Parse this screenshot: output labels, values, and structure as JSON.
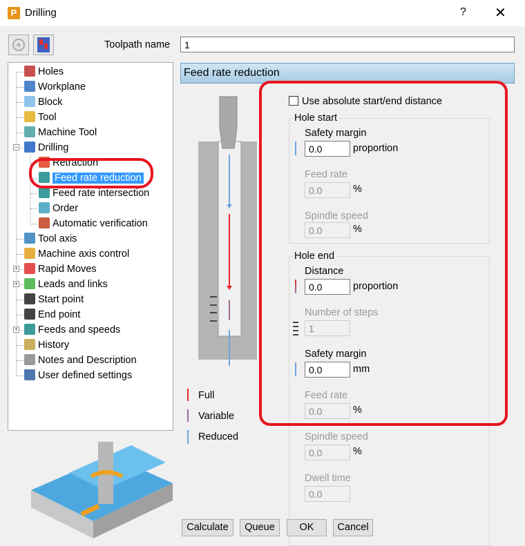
{
  "window": {
    "title": "Drilling",
    "help": "?",
    "close": "✕",
    "logo": "P"
  },
  "toolpath_name": {
    "label": "Toolpath name",
    "value": "1"
  },
  "tree": [
    {
      "label": "Holes",
      "level": 0,
      "icon": "holes-icon"
    },
    {
      "label": "Workplane",
      "level": 0,
      "icon": "workplane-icon"
    },
    {
      "label": "Block",
      "level": 0,
      "icon": "block-icon"
    },
    {
      "label": "Tool",
      "level": 0,
      "icon": "tool-icon"
    },
    {
      "label": "Machine Tool",
      "level": 0,
      "icon": "machine-tool-icon"
    },
    {
      "label": "Drilling",
      "level": 0,
      "icon": "drilling-icon",
      "expander": "−"
    },
    {
      "label": "Retraction",
      "level": 1,
      "icon": "retraction-icon"
    },
    {
      "label": "Feed rate reduction",
      "level": 1,
      "icon": "feed-rate-icon",
      "selected": true
    },
    {
      "label": "Feed rate intersection",
      "level": 1,
      "icon": "feed-rate-icon"
    },
    {
      "label": "Order",
      "level": 1,
      "icon": "order-icon"
    },
    {
      "label": "Automatic verification",
      "level": 1,
      "icon": "verification-icon"
    },
    {
      "label": "Tool axis",
      "level": 0,
      "icon": "tool-axis-icon"
    },
    {
      "label": "Machine axis control",
      "level": 0,
      "icon": "machine-axis-icon"
    },
    {
      "label": "Rapid Moves",
      "level": 0,
      "icon": "rapid-moves-icon",
      "expander": "+"
    },
    {
      "label": "Leads and links",
      "level": 0,
      "icon": "leads-links-icon",
      "expander": "+"
    },
    {
      "label": "Start point",
      "level": 0,
      "icon": "start-point-icon"
    },
    {
      "label": "End point",
      "level": 0,
      "icon": "end-point-icon"
    },
    {
      "label": "Feeds and speeds",
      "level": 0,
      "icon": "feeds-speeds-icon",
      "expander": "+"
    },
    {
      "label": "History",
      "level": 0,
      "icon": "history-icon"
    },
    {
      "label": "Notes and Description",
      "level": 0,
      "icon": "notes-icon"
    },
    {
      "label": "User defined settings",
      "level": 0,
      "icon": "user-settings-icon"
    }
  ],
  "panel": {
    "title": "Feed rate reduction"
  },
  "legend": {
    "full": "Full",
    "variable": "Variable",
    "reduced": "Reduced"
  },
  "form": {
    "absolute_label": "Use absolute start/end distance",
    "absolute_checked": false,
    "hole_start": {
      "title": "Hole start",
      "safety_margin": {
        "label": "Safety margin",
        "value": "0.0",
        "unit": "proportion"
      },
      "feed_rate": {
        "label": "Feed rate",
        "value": "0.0",
        "unit": "%"
      },
      "spindle_speed": {
        "label": "Spindle speed",
        "value": "0.0",
        "unit": "%"
      }
    },
    "hole_end": {
      "title": "Hole end",
      "distance": {
        "label": "Distance",
        "value": "0.0",
        "unit": "proportion"
      },
      "steps": {
        "label": "Number of steps",
        "value": "1"
      },
      "safety_margin": {
        "label": "Safety margin",
        "value": "0.0",
        "unit": "mm"
      },
      "feed_rate": {
        "label": "Feed rate",
        "value": "0.0",
        "unit": "%"
      },
      "spindle_speed": {
        "label": "Spindle speed",
        "value": "0.0",
        "unit": "%"
      },
      "dwell_time": {
        "label": "Dwell time",
        "value": "0.0"
      }
    }
  },
  "buttons": {
    "calculate": "Calculate",
    "queue": "Queue",
    "ok": "OK",
    "cancel": "Cancel"
  },
  "colors": {
    "full": "#e8262a",
    "reduced": "#6fa3dc",
    "highlight": "#e8141e",
    "selection": "#3399ff"
  }
}
